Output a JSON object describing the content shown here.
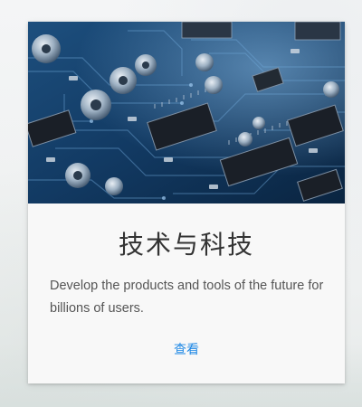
{
  "card": {
    "image_subject": "circuit board",
    "title": "技术与科技",
    "description": "Develop the products and tools of the future for billions of users.",
    "link_label": "查看",
    "colors": {
      "link": "#1e88e5",
      "title": "#333333",
      "text": "#555555",
      "card_background": "#f8f8f8"
    }
  }
}
